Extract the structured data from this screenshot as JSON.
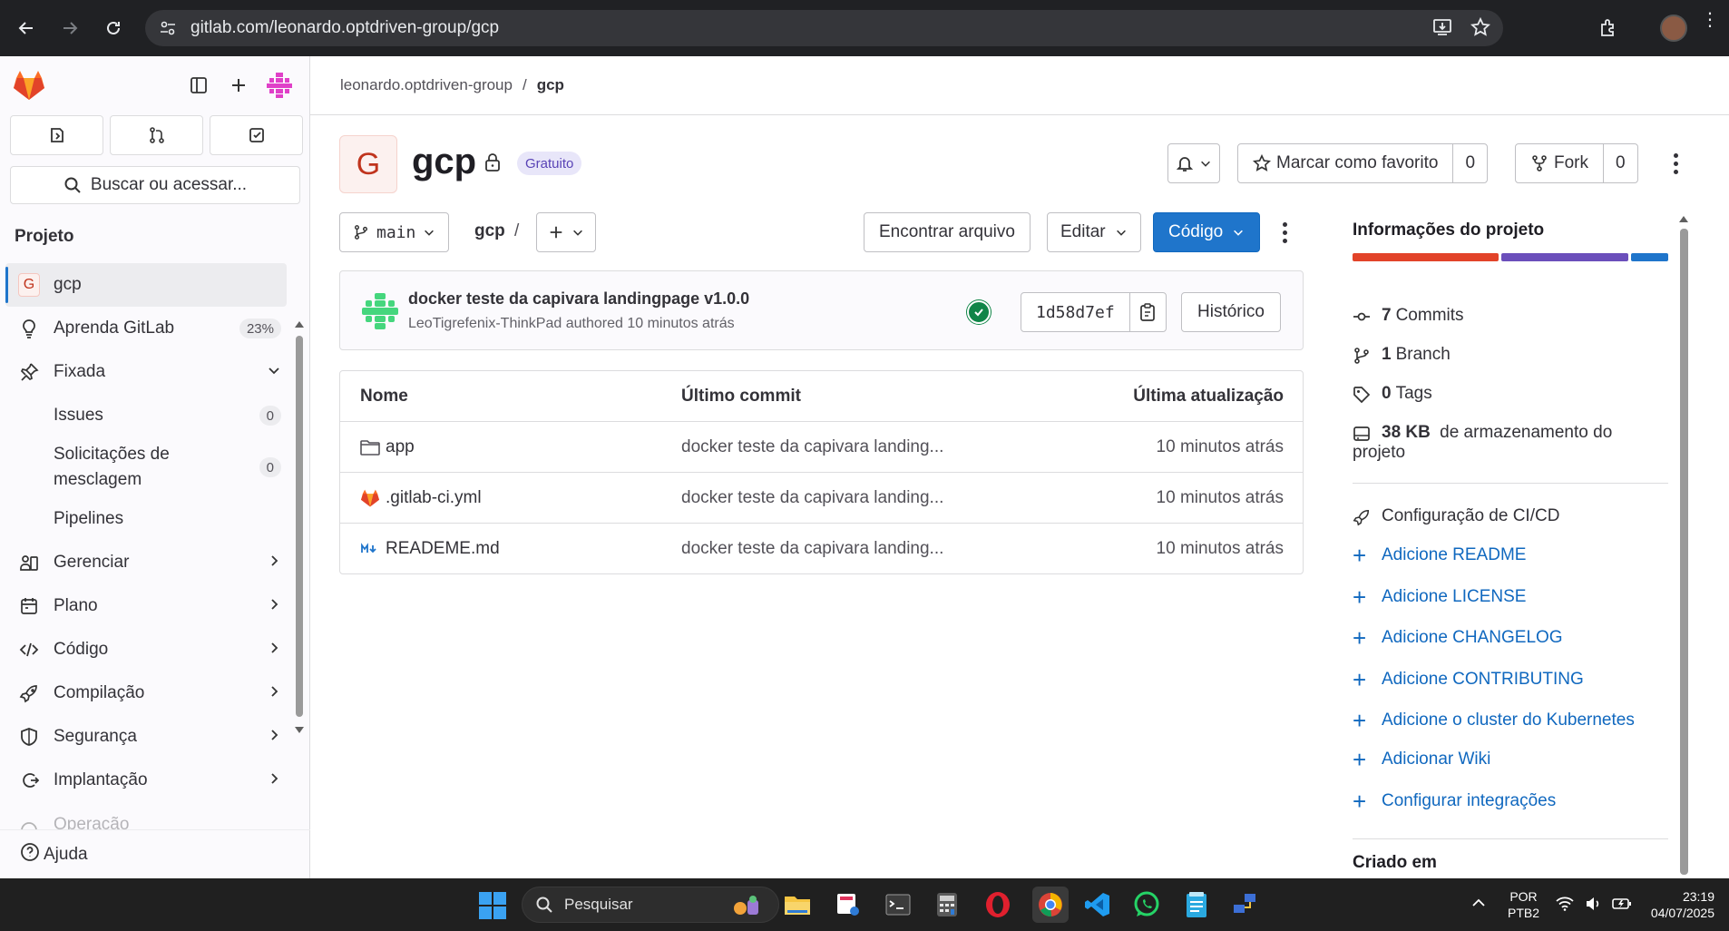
{
  "browser": {
    "url": "gitlab.com/leonardo.optdriven-group/gcp"
  },
  "sidebar": {
    "search_label": "Buscar ou acessar...",
    "section_title": "Projeto",
    "items": [
      {
        "label": "gcp",
        "icon": "project-avatar-g",
        "active": true
      },
      {
        "label": "Aprenda GitLab",
        "icon": "bulb-icon",
        "badge": "23%"
      },
      {
        "label": "Fixada",
        "icon": "pin-icon",
        "expanded": true
      },
      {
        "label": "Issues",
        "badge": "0",
        "sub": true
      },
      {
        "label": "Solicitações de mesclagem",
        "badge": "0",
        "sub": true
      },
      {
        "label": "Pipelines",
        "sub": true
      },
      {
        "label": "Gerenciar",
        "icon": "users-icon"
      },
      {
        "label": "Plano",
        "icon": "calendar-icon"
      },
      {
        "label": "Código",
        "icon": "code-icon"
      },
      {
        "label": "Compilação",
        "icon": "rocket-icon"
      },
      {
        "label": "Segurança",
        "icon": "shield-icon"
      },
      {
        "label": "Implantação",
        "icon": "deploy-icon"
      },
      {
        "label": "Operação",
        "icon": "operate-icon"
      }
    ],
    "help_label": "Ajuda"
  },
  "breadcrumb": {
    "group": "leonardo.optdriven-group",
    "separator": "/",
    "project": "gcp"
  },
  "project": {
    "avatar_letter": "G",
    "name": "gcp",
    "plan_badge": "Gratuito",
    "star_label": "Marcar como favorito",
    "star_count": "0",
    "fork_label": "Fork",
    "fork_count": "0"
  },
  "toolbar": {
    "branch": "main",
    "path_root": "gcp",
    "path_sep": "/",
    "find_file": "Encontrar arquivo",
    "edit": "Editar",
    "code": "Código"
  },
  "last_commit": {
    "title": "docker teste da capivara landingpage v1.0.0",
    "meta": "LeoTigrefenix-ThinkPad authored 10 minutos atrás",
    "sha": "1d58d7ef",
    "history": "Histórico"
  },
  "files": {
    "headers": [
      "Nome",
      "Último commit",
      "Última atualização"
    ],
    "rows": [
      {
        "name": "app",
        "icon": "folder-icon",
        "commit": "docker teste da capivara landing...",
        "updated": "10 minutos atrás"
      },
      {
        "name": ".gitlab-ci.yml",
        "icon": "gitlab-file-icon",
        "commit": "docker teste da capivara landing...",
        "updated": "10 minutos atrás"
      },
      {
        "name": "READEME.md",
        "icon": "markdown-icon",
        "commit": "docker teste da capivara landing...",
        "updated": "10 minutos atrás"
      }
    ]
  },
  "project_info": {
    "title": "Informações do projeto",
    "commits_count": "7",
    "commits_label": "Commits",
    "branch_count": "1",
    "branch_label": "Branch",
    "tags_count": "0",
    "tags_label": "Tags",
    "storage_size": "38 KB",
    "storage_label": "de armazenamento do projeto",
    "cicd_label": "Configuração de CI/CD",
    "links": [
      "Adicione README",
      "Adicione LICENSE",
      "Adicione CHANGELOG",
      "Adicione CONTRIBUTING",
      "Adicione o cluster do Kubernetes",
      "Adicionar Wiki",
      "Configurar integrações"
    ],
    "created_label": "Criado em",
    "language_colors": [
      "#e24329",
      "#6b4fbb",
      "#1f75cb"
    ],
    "language_fractions": [
      0.47,
      0.41,
      0.12
    ]
  },
  "taskbar": {
    "search_label": "Pesquisar",
    "lang_top": "POR",
    "lang_bottom": "PTB2",
    "time": "23:19",
    "date": "04/07/2025"
  }
}
